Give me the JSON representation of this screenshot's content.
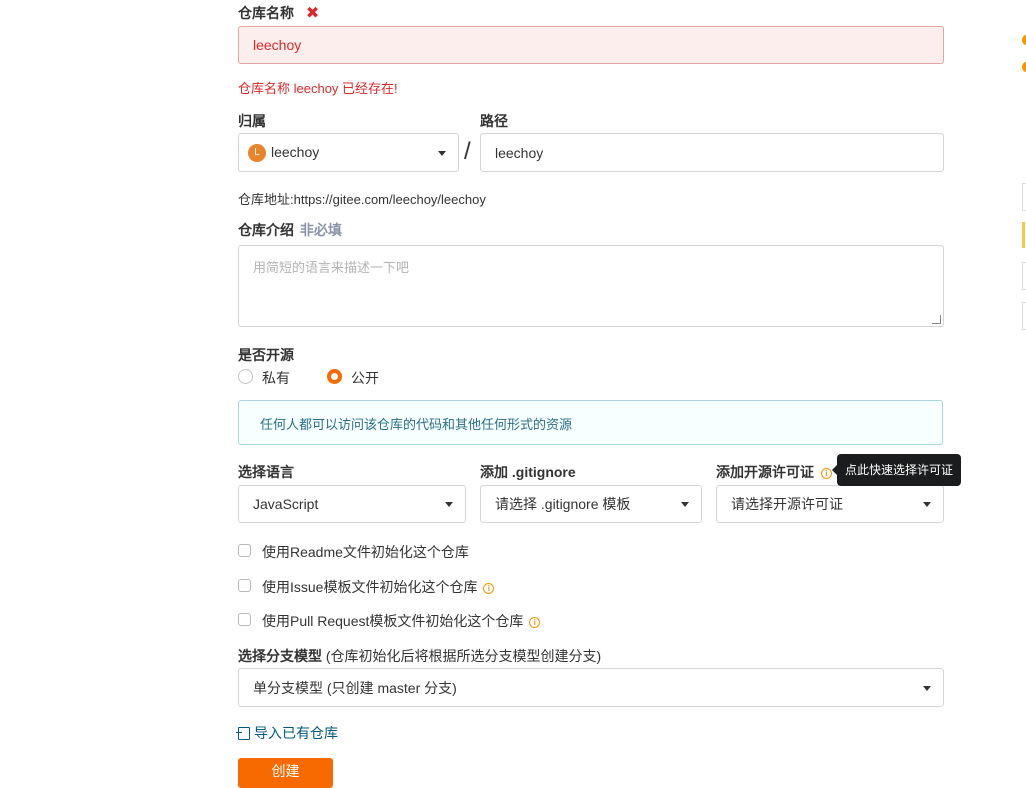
{
  "form": {
    "repo_name": {
      "label": "仓库名称",
      "required_icon": "x-mark-icon",
      "value": "leechoy",
      "error": "仓库名称 leechoy 已经存在!"
    },
    "owner": {
      "label": "归属",
      "avatar_letter": "L",
      "value": "leechoy"
    },
    "separator": "/",
    "path": {
      "label": "路径",
      "value": "leechoy"
    },
    "repo_address": {
      "label": "仓库地址:",
      "url": "https://gitee.com/leechoy/leechoy"
    },
    "description": {
      "label": "仓库介绍",
      "optional": "非必填",
      "placeholder": "用简短的语言来描述一下吧"
    },
    "visibility": {
      "label": "是否开源",
      "options": [
        {
          "label": "私有",
          "selected": false
        },
        {
          "label": "公开",
          "selected": true
        }
      ],
      "info_text": "任何人都可以访问该仓库的代码和其他任何形式的资源"
    },
    "language": {
      "label": "选择语言",
      "value": "JavaScript"
    },
    "gitignore": {
      "label": "添加 .gitignore",
      "value": "请选择 .gitignore 模板"
    },
    "license": {
      "label": "添加开源许可证",
      "value": "请选择开源许可证",
      "tooltip": "点此快速选择许可证"
    },
    "init_options": [
      {
        "label": "使用Readme文件初始化这个仓库",
        "checked": false,
        "has_info": false
      },
      {
        "label": "使用Issue模板文件初始化这个仓库",
        "checked": false,
        "has_info": true
      },
      {
        "label": "使用Pull Request模板文件初始化这个仓库",
        "checked": false,
        "has_info": true
      }
    ],
    "branch_model": {
      "label": "选择分支模型",
      "hint": "(仓库初始化后将根据所选分支模型创建分支)",
      "value": "单分支模型 (只创建 master 分支)"
    },
    "import_link": "导入已有仓库",
    "create_button": "创建"
  },
  "colors": {
    "accent": "#f76a02",
    "error": "#db2828",
    "error_bg": "#fdeeee",
    "info_border": "#a9d5de",
    "info_bg": "#f8ffff",
    "info_text": "#276f86",
    "link": "#005980",
    "tooltip_bg": "#1b1c1d"
  }
}
